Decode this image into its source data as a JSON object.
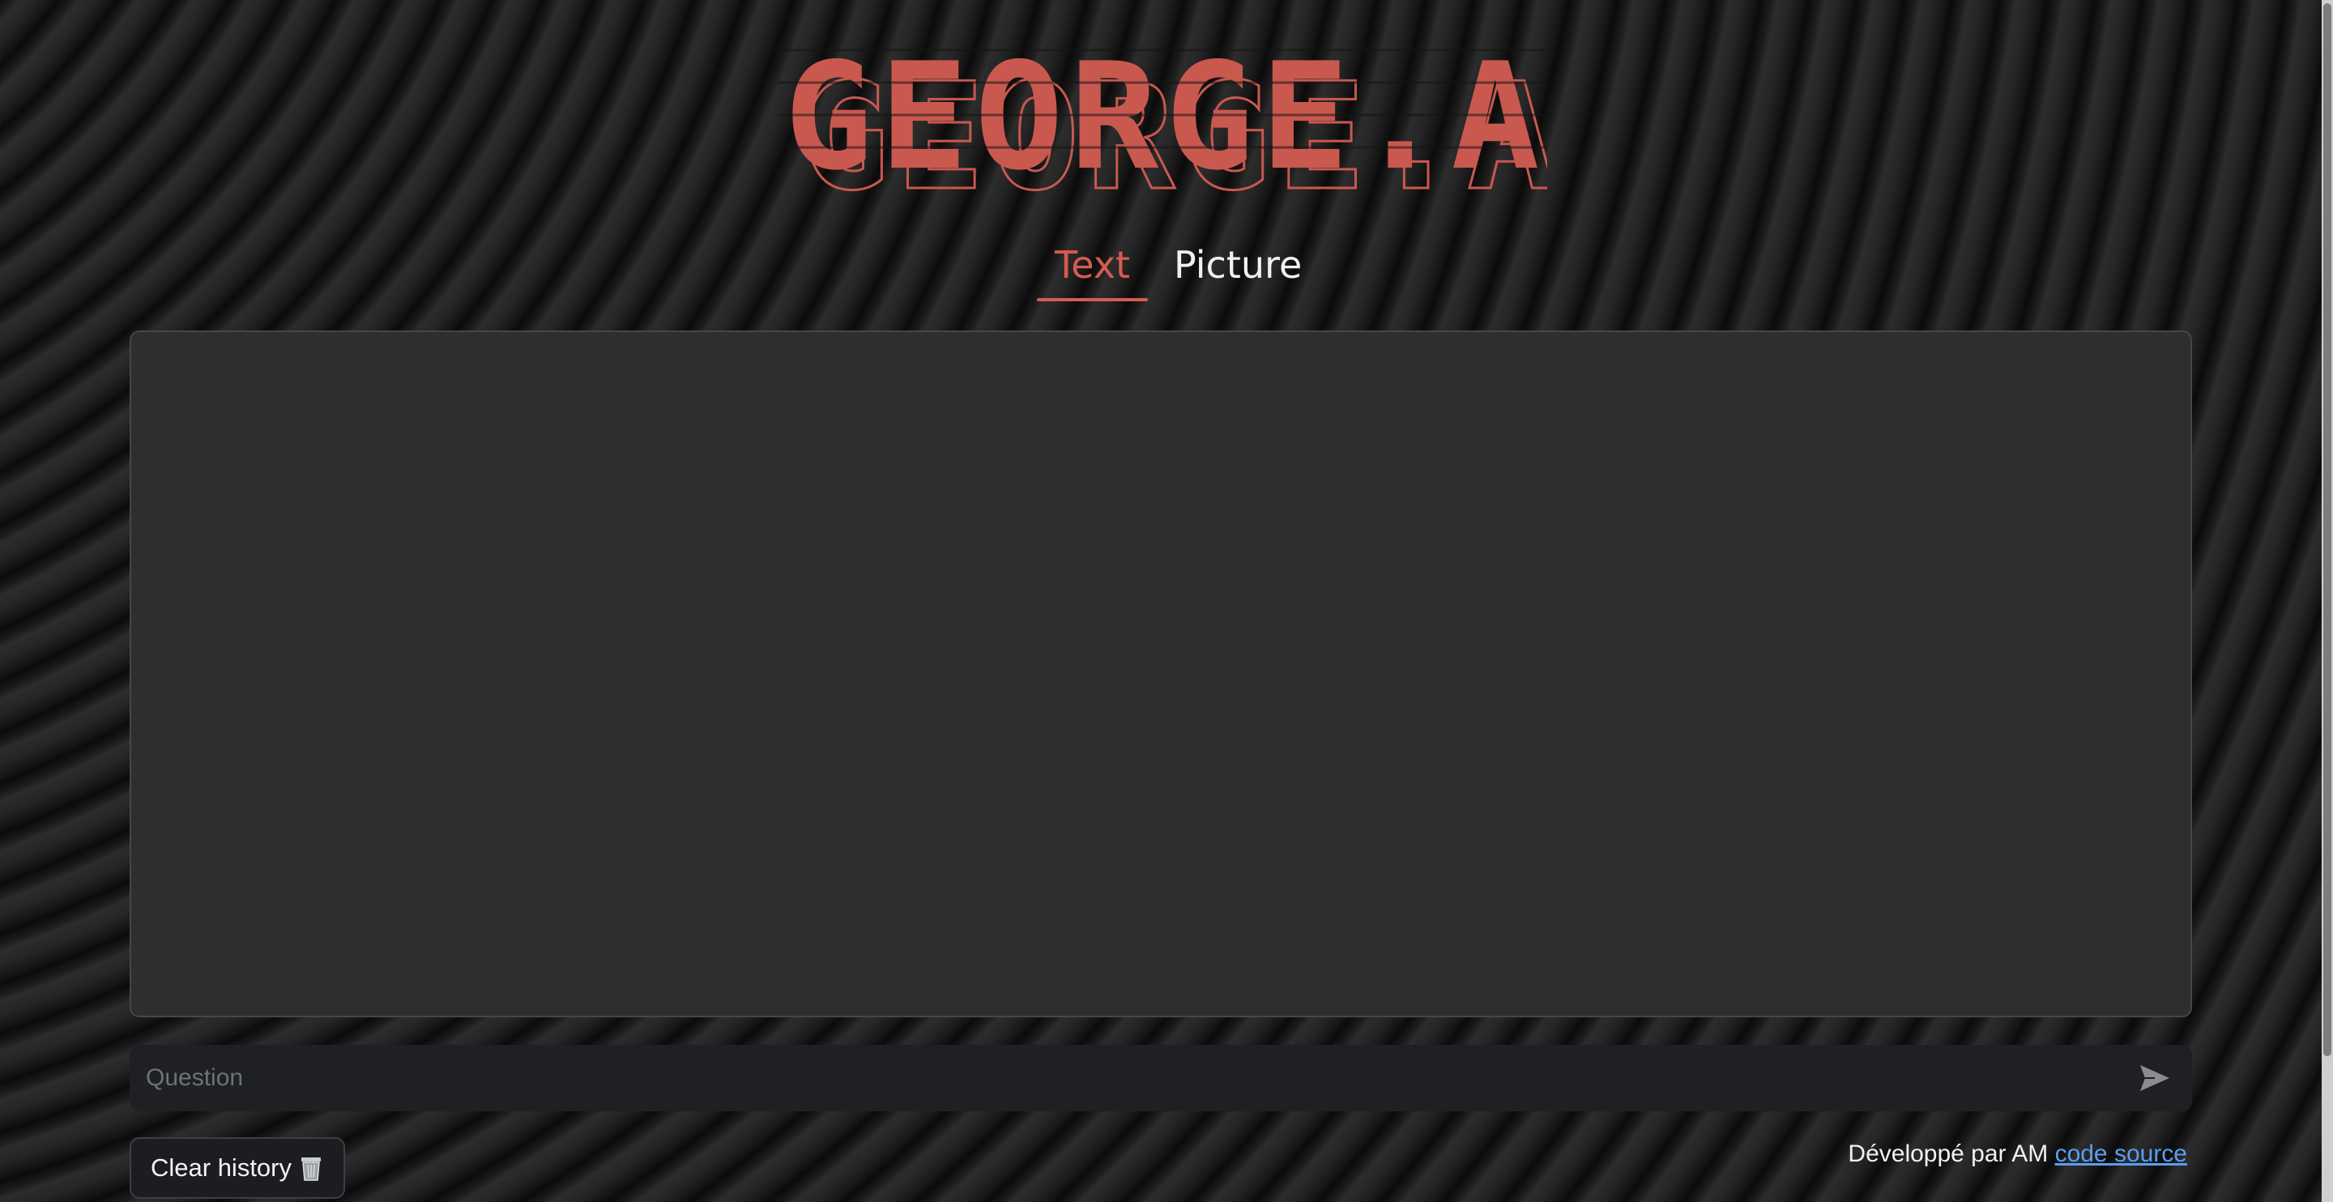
{
  "app": {
    "logo_text": "GEORGE.AI"
  },
  "tabs": [
    {
      "label": "Text",
      "active": true
    },
    {
      "label": "Picture",
      "active": false
    }
  ],
  "chat": {
    "messages": []
  },
  "input": {
    "placeholder": "Question",
    "value": ""
  },
  "actions": {
    "clear_label": "Clear history",
    "clear_icon": "trash-icon",
    "send_icon": "send-icon"
  },
  "footer": {
    "text": "Développé par AM",
    "link_label": "code source"
  },
  "colors": {
    "accent": "#d75b51",
    "link": "#5a9ef0",
    "panel": "#2e2e2e",
    "input_bg": "#1f2024"
  }
}
